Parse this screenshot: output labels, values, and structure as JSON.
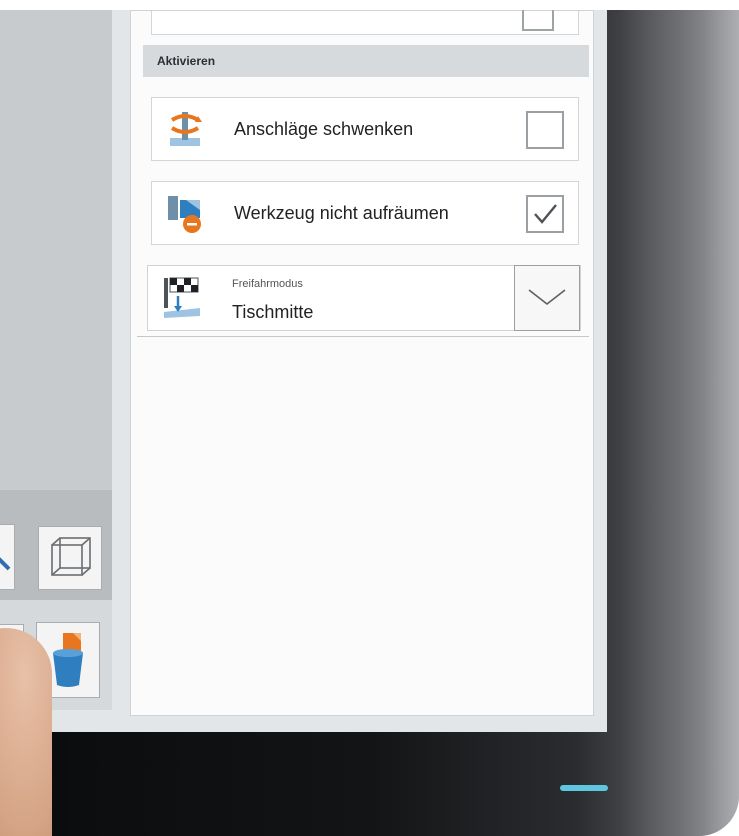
{
  "panel": {
    "section_title": "Aktivieren",
    "options": [
      {
        "label": "Anschläge schwenken",
        "checked": false,
        "icon": "pivot-stops-icon"
      },
      {
        "label": "Werkzeug nicht aufräumen",
        "checked": true,
        "icon": "tool-clear-icon"
      }
    ],
    "dropdown": {
      "caption": "Freifahrmodus",
      "value": "Tischmitte",
      "icon": "retract-mode-icon"
    }
  },
  "toolbar": {
    "icons": [
      "cube-view-icon",
      "delete-bucket-icon"
    ]
  },
  "colors": {
    "accent_led": "#5ec7df",
    "section_header_bg": "#d6dadc",
    "icon_blue": "#2f7fc0",
    "icon_orange": "#e8761f"
  }
}
